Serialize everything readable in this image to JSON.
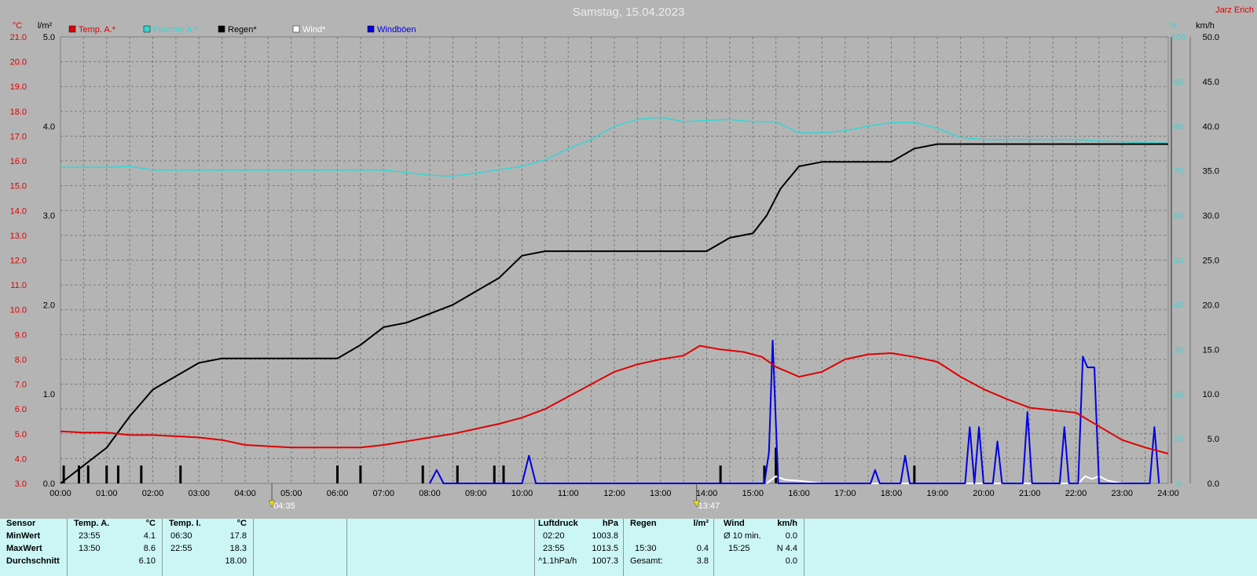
{
  "chart_data": {
    "type": "line",
    "title": "Samstag, 15.04.2023",
    "author": "Jarz Erich",
    "x_ticks": [
      "00:00",
      "01:00",
      "02:00",
      "03:00",
      "04:00",
      "05:00",
      "06:00",
      "07:00",
      "08:00",
      "09:00",
      "10:00",
      "11:00",
      "12:00",
      "13:00",
      "14:00",
      "15:00",
      "16:00",
      "17:00",
      "18:00",
      "19:00",
      "20:00",
      "21:00",
      "22:00",
      "23:00",
      "24:00"
    ],
    "xlim_hours": [
      0,
      24
    ],
    "axes": {
      "temp": {
        "label": "°C",
        "ylim": [
          3.0,
          21.0
        ],
        "ticks": [
          "3.0",
          "4.0",
          "5.0",
          "6.0",
          "7.0",
          "8.0",
          "9.0",
          "10.0",
          "11.0",
          "12.0",
          "13.0",
          "14.0",
          "15.0",
          "16.0",
          "17.0",
          "18.0",
          "19.0",
          "20.0",
          "21.0"
        ],
        "color": "#e00000"
      },
      "rain": {
        "label": "l/m²",
        "ylim": [
          0.0,
          5.0
        ],
        "ticks": [
          "0.0",
          "1.0",
          "2.0",
          "3.0",
          "4.0",
          "5.0"
        ],
        "color": "#000000"
      },
      "humidity": {
        "label": "%",
        "ylim": [
          0,
          100
        ],
        "ticks": [
          "0",
          "10",
          "20",
          "30",
          "40",
          "50",
          "60",
          "70",
          "80",
          "90",
          "100"
        ],
        "color": "#33d6d6"
      },
      "wind": {
        "label": "km/h",
        "ylim": [
          0.0,
          50.0
        ],
        "ticks": [
          "0.0",
          "5.0",
          "10.0",
          "15.0",
          "20.0",
          "25.0",
          "30.0",
          "35.0",
          "40.0",
          "45.0",
          "50.0"
        ],
        "color": "#000000"
      }
    },
    "grid": true,
    "legend_position": "top-left",
    "legend": [
      {
        "name": "Temp. A.*",
        "color": "#e00000"
      },
      {
        "name": "Feuchte A.*",
        "color": "#33d6d6"
      },
      {
        "name": "Regen*",
        "color": "#000000"
      },
      {
        "name": "Wind*",
        "color": "#ffffff"
      },
      {
        "name": "Windböen",
        "color": "#0000e0"
      }
    ],
    "markers": [
      {
        "time": "04:35",
        "hour": 4.58
      },
      {
        "time": "13:47",
        "hour": 13.78
      }
    ],
    "series": [
      {
        "name": "Temp. A.*",
        "axis": "temp",
        "color": "#e00000",
        "points": [
          [
            0,
            5.1
          ],
          [
            0.5,
            5.05
          ],
          [
            1,
            5.05
          ],
          [
            1.5,
            4.95
          ],
          [
            2,
            4.95
          ],
          [
            2.5,
            4.9
          ],
          [
            3,
            4.85
          ],
          [
            3.5,
            4.75
          ],
          [
            4,
            4.55
          ],
          [
            4.5,
            4.5
          ],
          [
            5,
            4.45
          ],
          [
            5.5,
            4.45
          ],
          [
            6,
            4.45
          ],
          [
            6.5,
            4.45
          ],
          [
            7,
            4.55
          ],
          [
            7.5,
            4.7
          ],
          [
            8,
            4.85
          ],
          [
            8.5,
            5.0
          ],
          [
            9,
            5.2
          ],
          [
            9.5,
            5.4
          ],
          [
            10,
            5.65
          ],
          [
            10.5,
            6.0
          ],
          [
            11,
            6.5
          ],
          [
            11.5,
            7.0
          ],
          [
            12,
            7.5
          ],
          [
            12.5,
            7.8
          ],
          [
            13,
            8.0
          ],
          [
            13.5,
            8.15
          ],
          [
            13.85,
            8.55
          ],
          [
            14.3,
            8.4
          ],
          [
            14.8,
            8.3
          ],
          [
            15.2,
            8.1
          ],
          [
            15.5,
            7.7
          ],
          [
            16,
            7.3
          ],
          [
            16.5,
            7.5
          ],
          [
            17,
            8.0
          ],
          [
            17.5,
            8.2
          ],
          [
            18,
            8.25
          ],
          [
            18.5,
            8.1
          ],
          [
            19,
            7.9
          ],
          [
            19.5,
            7.3
          ],
          [
            20,
            6.8
          ],
          [
            20.5,
            6.4
          ],
          [
            21,
            6.05
          ],
          [
            21.5,
            5.95
          ],
          [
            22,
            5.85
          ],
          [
            22.5,
            5.3
          ],
          [
            23,
            4.75
          ],
          [
            23.5,
            4.45
          ],
          [
            24,
            4.2
          ]
        ]
      },
      {
        "name": "Feuchte A.*",
        "axis": "humidity",
        "color": "#33d6d6",
        "points": [
          [
            0,
            70.8
          ],
          [
            1,
            70.8
          ],
          [
            1.5,
            71.0
          ],
          [
            2,
            70.2
          ],
          [
            3,
            70.2
          ],
          [
            4,
            70.2
          ],
          [
            5,
            70.2
          ],
          [
            6,
            70.2
          ],
          [
            7,
            70.2
          ],
          [
            8,
            69.0
          ],
          [
            8.5,
            68.8
          ],
          [
            9,
            69.5
          ],
          [
            10,
            71.0
          ],
          [
            10.5,
            72.5
          ],
          [
            11,
            75.0
          ],
          [
            11.5,
            77.0
          ],
          [
            12,
            80.0
          ],
          [
            12.5,
            81.5
          ],
          [
            13,
            82.0
          ],
          [
            13.5,
            81.0
          ],
          [
            14,
            81.3
          ],
          [
            14.5,
            81.5
          ],
          [
            15,
            81.0
          ],
          [
            15.5,
            81.0
          ],
          [
            16,
            78.5
          ],
          [
            16.5,
            78.5
          ],
          [
            17,
            79.0
          ],
          [
            17.5,
            80.0
          ],
          [
            18,
            80.8
          ],
          [
            18.5,
            80.8
          ],
          [
            19,
            79.5
          ],
          [
            19.5,
            77.5
          ],
          [
            20,
            77.0
          ],
          [
            21,
            77.0
          ],
          [
            22,
            77.0
          ],
          [
            22.5,
            76.7
          ],
          [
            23,
            76.5
          ],
          [
            24,
            76.2
          ]
        ]
      },
      {
        "name": "Regen*",
        "axis": "rain",
        "color": "#000000",
        "points": [
          [
            0,
            0.0
          ],
          [
            0.25,
            0.1
          ],
          [
            0.5,
            0.2
          ],
          [
            1,
            0.4
          ],
          [
            1.5,
            0.75
          ],
          [
            2,
            1.05
          ],
          [
            2.5,
            1.2
          ],
          [
            3,
            1.35
          ],
          [
            3.5,
            1.4
          ],
          [
            4,
            1.4
          ],
          [
            5,
            1.4
          ],
          [
            6,
            1.4
          ],
          [
            6.5,
            1.55
          ],
          [
            7,
            1.75
          ],
          [
            7.5,
            1.8
          ],
          [
            8,
            1.9
          ],
          [
            8.5,
            2.0
          ],
          [
            9,
            2.15
          ],
          [
            9.5,
            2.3
          ],
          [
            10,
            2.55
          ],
          [
            10.5,
            2.6
          ],
          [
            11,
            2.6
          ],
          [
            12,
            2.6
          ],
          [
            13,
            2.6
          ],
          [
            14,
            2.6
          ],
          [
            14.5,
            2.75
          ],
          [
            15,
            2.8
          ],
          [
            15.3,
            3.0
          ],
          [
            15.6,
            3.3
          ],
          [
            16,
            3.55
          ],
          [
            16.5,
            3.6
          ],
          [
            17,
            3.6
          ],
          [
            18,
            3.6
          ],
          [
            18.5,
            3.75
          ],
          [
            19,
            3.8
          ],
          [
            20,
            3.8
          ],
          [
            21,
            3.8
          ],
          [
            22,
            3.8
          ],
          [
            23,
            3.8
          ],
          [
            24,
            3.8
          ]
        ]
      },
      {
        "name": "Regen-Balken",
        "axis": "rain",
        "color": "#000000",
        "type": "bar",
        "points": [
          [
            0.07,
            0.2
          ],
          [
            0.4,
            0.2
          ],
          [
            0.6,
            0.2
          ],
          [
            1.0,
            0.2
          ],
          [
            1.25,
            0.2
          ],
          [
            1.75,
            0.2
          ],
          [
            2.6,
            0.2
          ],
          [
            6.0,
            0.2
          ],
          [
            6.5,
            0.2
          ],
          [
            7.85,
            0.2
          ],
          [
            8.6,
            0.2
          ],
          [
            9.4,
            0.2
          ],
          [
            9.6,
            0.2
          ],
          [
            14.3,
            0.2
          ],
          [
            15.25,
            0.2
          ],
          [
            15.5,
            0.4
          ],
          [
            18.5,
            0.2
          ]
        ]
      },
      {
        "name": "Wind*",
        "axis": "wind",
        "color": "#ffffff",
        "points": [
          [
            15.3,
            0.0
          ],
          [
            15.5,
            0.8
          ],
          [
            15.7,
            0.4
          ],
          [
            16,
            0.3
          ],
          [
            16.5,
            0.0
          ],
          [
            22.05,
            0.0
          ],
          [
            22.2,
            0.8
          ],
          [
            22.35,
            0.5
          ],
          [
            22.5,
            0.8
          ],
          [
            22.7,
            0.3
          ],
          [
            23,
            0.0
          ]
        ]
      },
      {
        "name": "Windböen",
        "axis": "wind",
        "color": "#0000e0",
        "points": [
          [
            8.0,
            0
          ],
          [
            8.15,
            1.5
          ],
          [
            8.3,
            0
          ],
          [
            10.0,
            0
          ],
          [
            10.15,
            3.1
          ],
          [
            10.3,
            0
          ],
          [
            15.25,
            0
          ],
          [
            15.35,
            3.5
          ],
          [
            15.43,
            16.0
          ],
          [
            15.55,
            0
          ],
          [
            17.55,
            0
          ],
          [
            17.65,
            1.5
          ],
          [
            17.75,
            0
          ],
          [
            18.2,
            0
          ],
          [
            18.3,
            3.1
          ],
          [
            18.4,
            0
          ],
          [
            19.6,
            0
          ],
          [
            19.7,
            6.3
          ],
          [
            19.8,
            0
          ],
          [
            19.9,
            6.3
          ],
          [
            20.0,
            0
          ],
          [
            20.2,
            0
          ],
          [
            20.3,
            4.7
          ],
          [
            20.4,
            0
          ],
          [
            20.85,
            0
          ],
          [
            20.95,
            8.0
          ],
          [
            21.05,
            0
          ],
          [
            21.65,
            0
          ],
          [
            21.75,
            6.3
          ],
          [
            21.85,
            0
          ],
          [
            22.05,
            0
          ],
          [
            22.15,
            14.2
          ],
          [
            22.25,
            13.0
          ],
          [
            22.4,
            13.0
          ],
          [
            22.5,
            0
          ],
          [
            23.6,
            0
          ],
          [
            23.7,
            6.3
          ],
          [
            23.8,
            0
          ]
        ]
      }
    ]
  },
  "table": {
    "sensor": {
      "header": "Sensor",
      "rows": [
        "MinWert",
        "MaxWert",
        "Durchschnitt"
      ]
    },
    "temp_a": {
      "header": "Temp. A.",
      "unit": "°C",
      "times": [
        "23:55",
        "13:50",
        ""
      ],
      "values": [
        "4.1",
        "8.6",
        "6.10"
      ]
    },
    "temp_i": {
      "header": "Temp. I.",
      "unit": "°C",
      "times": [
        "06:30",
        "22:55",
        ""
      ],
      "values": [
        "17.8",
        "18.3",
        "18.00"
      ]
    },
    "pressure": {
      "header": "Luftdruck",
      "unit": "hPa",
      "times": [
        "02:20",
        "23:55",
        "^1.1hPa/h"
      ],
      "values": [
        "1003.8",
        "1013.5",
        "1007.3"
      ]
    },
    "rain": {
      "header": "Regen",
      "unit": "l/m²",
      "times": [
        "",
        "15:30",
        "Gesamt:"
      ],
      "values": [
        "",
        "0.4",
        "3.8"
      ]
    },
    "wind": {
      "header": "Wind",
      "unit": "km/h",
      "times": [
        "Ø 10 min.",
        "15:25",
        ""
      ],
      "values": [
        "0.0",
        "N 4.4",
        "0.0"
      ]
    }
  }
}
